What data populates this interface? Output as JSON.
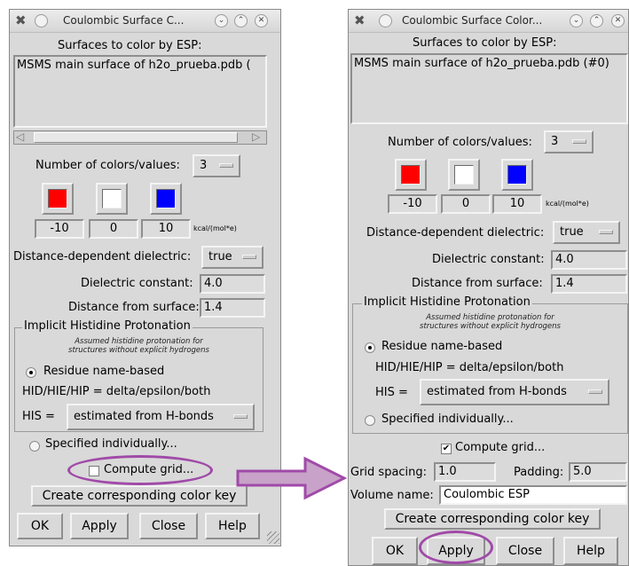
{
  "colors": {
    "accent_purple": "#a04aa8",
    "arrow_fill": "#c8a2c8",
    "swatch_red": "#ff0000",
    "swatch_white": "#ffffff",
    "swatch_blue": "#0000ff"
  },
  "left_window": {
    "title": "Coulombic Surface C...",
    "surfaces_label": "Surfaces to color by ESP:",
    "surface_item": "MSMS main surface of h2o_prueba.pdb (",
    "num_colors_label": "Number of colors/values:",
    "num_colors_value": "3",
    "values": [
      "-10",
      "0",
      "10"
    ],
    "unit": "kcal/(mol*e)",
    "dielectric_dep_label": "Distance-dependent dielectric:",
    "dielectric_dep_value": "true",
    "dielectric_const_label": "Dielectric constant:",
    "dielectric_const_value": "4.0",
    "dist_surface_label": "Distance from surface:",
    "dist_surface_value": "1.4",
    "his_group_title": "Implicit Histidine Protonation",
    "his_note_line1": "Assumed histidine protonation for",
    "his_note_line2": "structures without explicit hydrogens",
    "radio_residue": "Residue name-based",
    "hid_line": "HID/HIE/HIP = delta/epsilon/both",
    "his_label": "HIS =",
    "his_value": "estimated from H-bonds",
    "radio_specified": "Specified individually...",
    "compute_grid": "Compute grid...",
    "color_key": "Create corresponding color key",
    "buttons": {
      "ok": "OK",
      "apply": "Apply",
      "close": "Close",
      "help": "Help"
    }
  },
  "right_window": {
    "title": "Coulombic Surface Color...",
    "surfaces_label": "Surfaces to color by ESP:",
    "surface_item": "MSMS main surface of h2o_prueba.pdb (#0)",
    "num_colors_label": "Number of colors/values:",
    "num_colors_value": "3",
    "values": [
      "-10",
      "0",
      "10"
    ],
    "unit": "kcal/(mol*e)",
    "dielectric_dep_label": "Distance-dependent dielectric:",
    "dielectric_dep_value": "true",
    "dielectric_const_label": "Dielectric constant:",
    "dielectric_const_value": "4.0",
    "dist_surface_label": "Distance from surface:",
    "dist_surface_value": "1.4",
    "his_group_title": "Implicit Histidine Protonation",
    "his_note_line1": "Assumed histidine protonation for",
    "his_note_line2": "structures without explicit hydrogens",
    "radio_residue": "Residue name-based",
    "hid_line": "HID/HIE/HIP = delta/epsilon/both",
    "his_label": "HIS =",
    "his_value": "estimated from H-bonds",
    "radio_specified": "Specified individually...",
    "compute_grid": "Compute grid...",
    "grid_spacing_label": "Grid spacing:",
    "grid_spacing_value": "1.0",
    "padding_label": "Padding:",
    "padding_value": "5.0",
    "volume_name_label": "Volume name:",
    "volume_name_value": "Coulombic ESP",
    "color_key": "Create corresponding color key",
    "buttons": {
      "ok": "OK",
      "apply": "Apply",
      "close": "Close",
      "help": "Help"
    }
  },
  "icons": {
    "app": "tools-icon",
    "menu": "circle-menu-icon",
    "minimize": "chevron-down-icon",
    "maximize": "chevron-up-icon",
    "close": "close-icon"
  }
}
